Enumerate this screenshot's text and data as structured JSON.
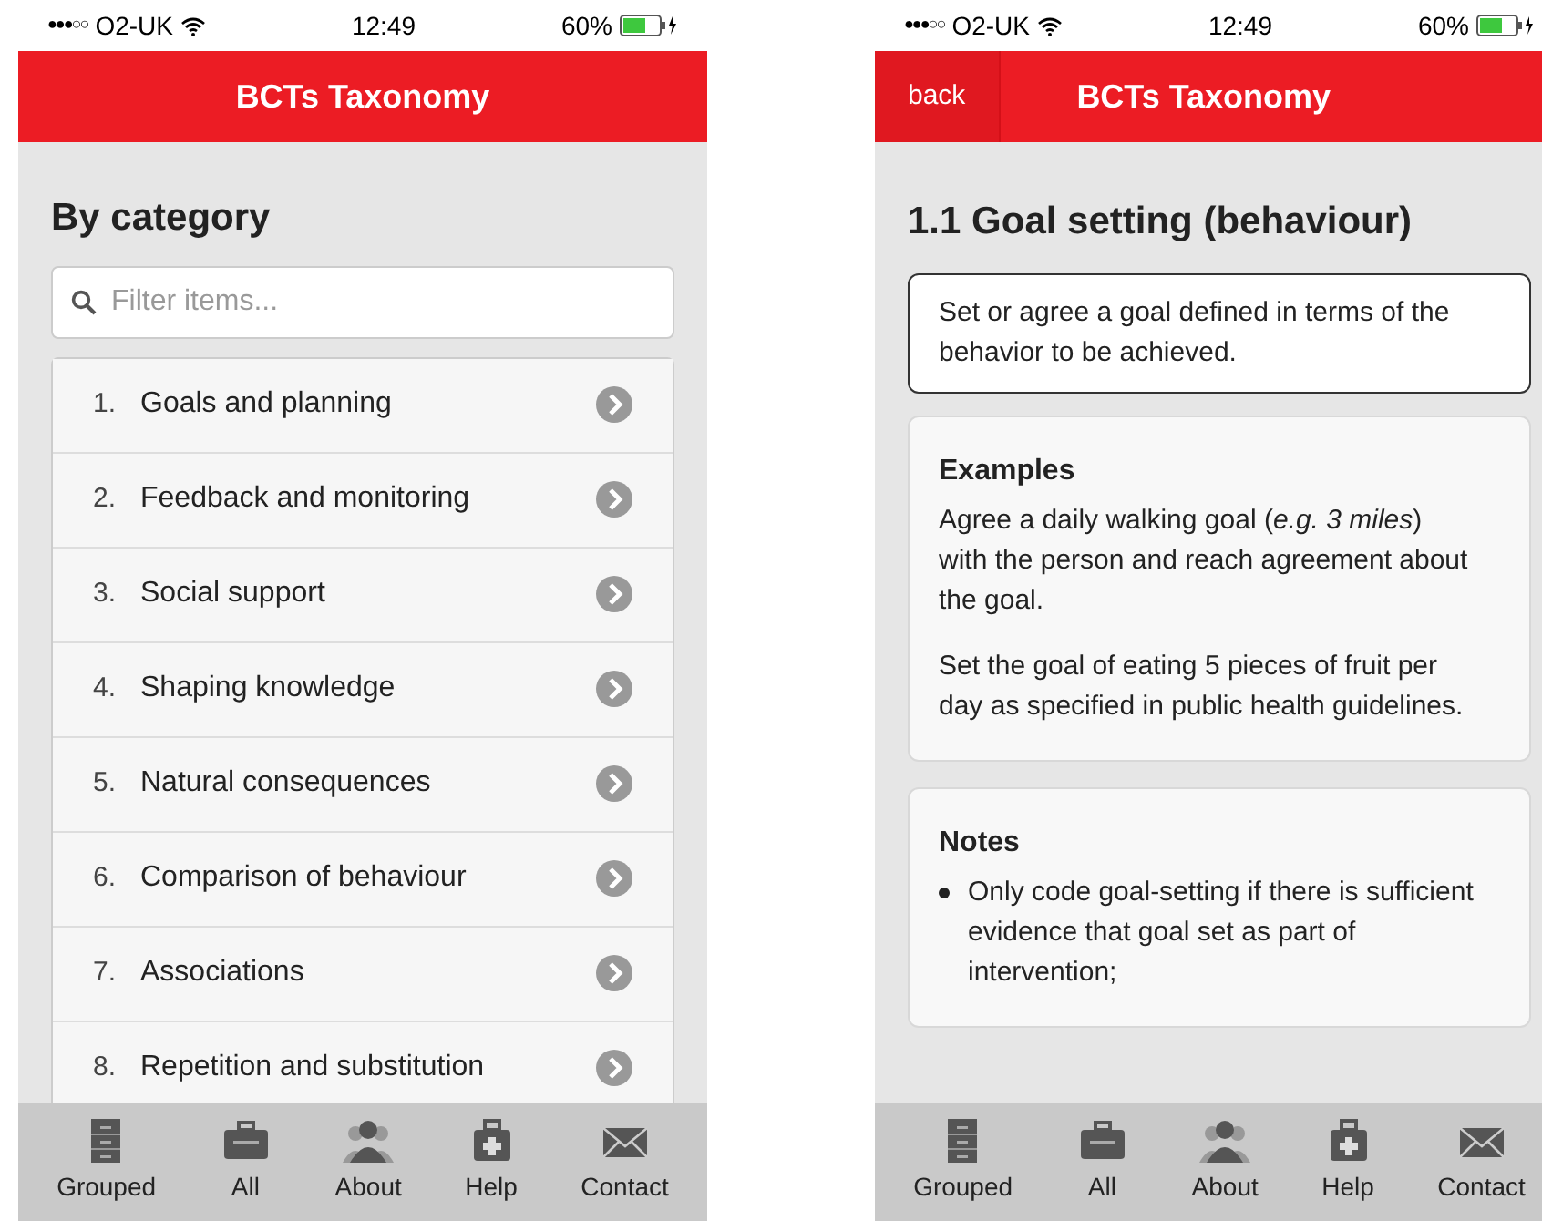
{
  "screens": [
    {
      "kind": "list",
      "status_bar": {
        "signal": "●●●○○",
        "carrier": "O2-UK",
        "time": "12:49",
        "battery": "60%"
      },
      "header": {
        "title": "BCTs Taxonomy"
      },
      "heading": "By category",
      "filter": {
        "placeholder": "Filter items..."
      },
      "items": [
        {
          "number": "1.",
          "label": "Goals and planning"
        },
        {
          "number": "2.",
          "label": "Feedback and monitoring"
        },
        {
          "number": "3.",
          "label": "Social support"
        },
        {
          "number": "4.",
          "label": "Shaping knowledge"
        },
        {
          "number": "5.",
          "label": "Natural consequences"
        },
        {
          "number": "6.",
          "label": "Comparison of behaviour"
        },
        {
          "number": "7.",
          "label": "Associations"
        },
        {
          "number": "8.",
          "label": "Repetition and substitution"
        }
      ],
      "tab_bar": [
        {
          "kind": "cabinet",
          "label": "Grouped"
        },
        {
          "kind": "toolbox",
          "label": "All"
        },
        {
          "kind": "people",
          "label": "About"
        },
        {
          "kind": "medkit",
          "label": "Help"
        },
        {
          "kind": "mail",
          "label": "Contact"
        }
      ]
    },
    {
      "kind": "detail",
      "status_bar": {
        "signal": "●●●○○",
        "carrier": "O2-UK",
        "time": "12:49",
        "battery": "60%"
      },
      "header": {
        "back": "back",
        "title": "BCTs Taxonomy"
      },
      "heading": "1.1 Goal setting (behaviour)",
      "definition": "Set or agree a goal defined in terms of the behavior to be achieved.",
      "sections": [
        {
          "kind": "paragraphs",
          "title": "Examples",
          "paragraphs": [
            "Agree a daily walking goal (*e.g. 3 miles*) with the person and reach agreement about the goal.",
            "Set the goal of eating 5 pieces of fruit per day as specified in public health guidelines."
          ]
        },
        {
          "kind": "bullets",
          "title": "Notes",
          "bullets": [
            "Only code goal-setting if there is sufficient evidence that goal set as part of intervention;"
          ]
        }
      ],
      "tab_bar": [
        {
          "kind": "cabinet",
          "label": "Grouped"
        },
        {
          "kind": "toolbox",
          "label": "All"
        },
        {
          "kind": "people",
          "label": "About"
        },
        {
          "kind": "medkit",
          "label": "Help"
        },
        {
          "kind": "mail",
          "label": "Contact"
        }
      ]
    }
  ]
}
